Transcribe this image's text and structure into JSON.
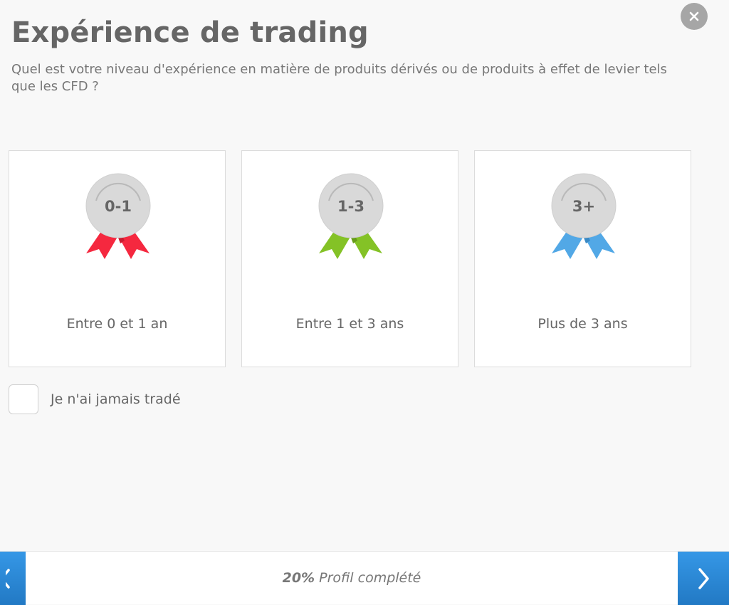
{
  "header": {
    "title": "Expérience de trading",
    "question": "Quel est votre niveau d'expérience en matière de produits dérivés ou de produits à effet de levier tels que les CFD ?"
  },
  "options": [
    {
      "badge": "0-1",
      "caption": "Entre 0 et 1 an",
      "ribbon_color": "#f5283f",
      "ribbon_shadow": "#c91c30"
    },
    {
      "badge": "1-3",
      "caption": "Entre 1 et 3 ans",
      "ribbon_color": "#84c226",
      "ribbon_shadow": "#679c1a"
    },
    {
      "badge": "3+",
      "caption": "Plus de 3 ans",
      "ribbon_color": "#52a8e6",
      "ribbon_shadow": "#3a89c4"
    }
  ],
  "never_traded": {
    "label": "Je n'ai jamais tradé",
    "checked": false
  },
  "footer": {
    "progress_percent": "20%",
    "progress_text": "Profil complété"
  },
  "icons": {
    "close": "close-icon",
    "prev": "chevron-left-icon",
    "next": "chevron-right-icon",
    "medal": "medal-icon"
  },
  "colors": {
    "accent": "#2e8ad6",
    "title": "#666666",
    "medal_disc": "#d9d9d9"
  }
}
